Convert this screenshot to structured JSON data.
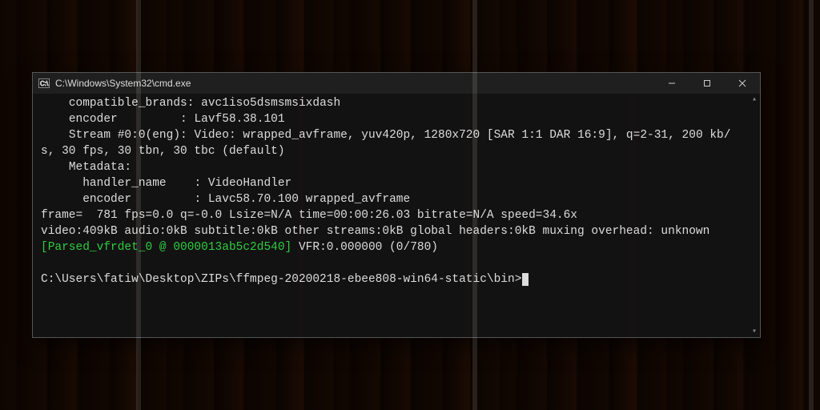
{
  "window": {
    "title": "C:\\Windows\\System32\\cmd.exe"
  },
  "terminal": {
    "lines": {
      "l1": "    compatible_brands: avc1iso5dsmsmsixdash",
      "l2": "    encoder         : Lavf58.38.101",
      "l3": "    Stream #0:0(eng): Video: wrapped_avframe, yuv420p, 1280x720 [SAR 1:1 DAR 16:9], q=2-31, 200 kb/s, 30 fps, 30 tbn, 30 tbc (default)",
      "l4": "    Metadata:",
      "l5": "      handler_name    : VideoHandler",
      "l6": "      encoder         : Lavc58.70.100 wrapped_avframe",
      "l7": "frame=  781 fps=0.0 q=-0.0 Lsize=N/A time=00:00:26.03 bitrate=N/A speed=34.6x",
      "l8": "video:409kB audio:0kB subtitle:0kB other streams:0kB global headers:0kB muxing overhead: unknown",
      "l9g": "[Parsed_vfrdet_0 @ 0000013ab5c2d540]",
      "l9b": " VFR:0.000000 (0/780)",
      "blank": "",
      "prompt": "C:\\Users\\fatiw\\Desktop\\ZIPs\\ffmpeg-20200218-ebee808-win64-static\\bin>"
    }
  }
}
